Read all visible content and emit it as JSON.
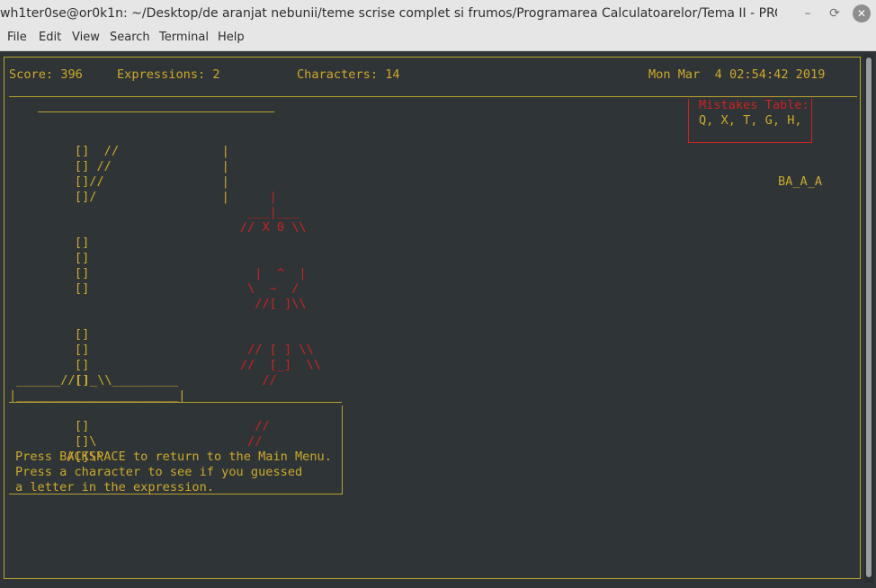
{
  "window": {
    "title": "wh1ter0se@or0k1n: ~/Desktop/de aranjat nebunii/teme scrise complet si frumos/Programarea Calculatoarelor/Tema II  - PRC",
    "minimize_glyph": "–",
    "restore_glyph": "⟳",
    "close_glyph": "✕"
  },
  "menu": [
    "File",
    "Edit",
    "View",
    "Search",
    "Terminal",
    "Help"
  ],
  "status": {
    "score": "Score: 396",
    "expressions": "Expressions: 2",
    "characters": "Characters: 14",
    "datetime": "Mon Mar  4 02:54:42 2019"
  },
  "mistakes": {
    "title": "Mistakes Table:",
    "letters": "Q, X, T, G, H,"
  },
  "expression": "BA_A_A",
  "gallows": [
    "     []  //              |",
    "     [] //               |",
    "     []//                |",
    "     []/                 |",
    "     []",
    "     []",
    "     []",
    "     []",
    "     []",
    "     []",
    "     []",
    "     []",
    "     []",
    "     []\\",
    "    /[]\\\\",
    " ______//[]_\\\\_________",
    "|______________________|"
  ],
  "hangman": [
    "         |",
    "      ___|___",
    "     // X 0 \\\\",
    "       |  ^  |",
    "      \\  ~  /",
    "       //[ ]\\\\",
    "      // [ ] \\\\",
    "     //  [_]  \\\\",
    "        //",
    "       //",
    "      //"
  ],
  "instructions": [
    "Press BACKSPACE to return to the Main Menu.",
    "Press a character to see if you guessed",
    "a letter in the expression."
  ]
}
